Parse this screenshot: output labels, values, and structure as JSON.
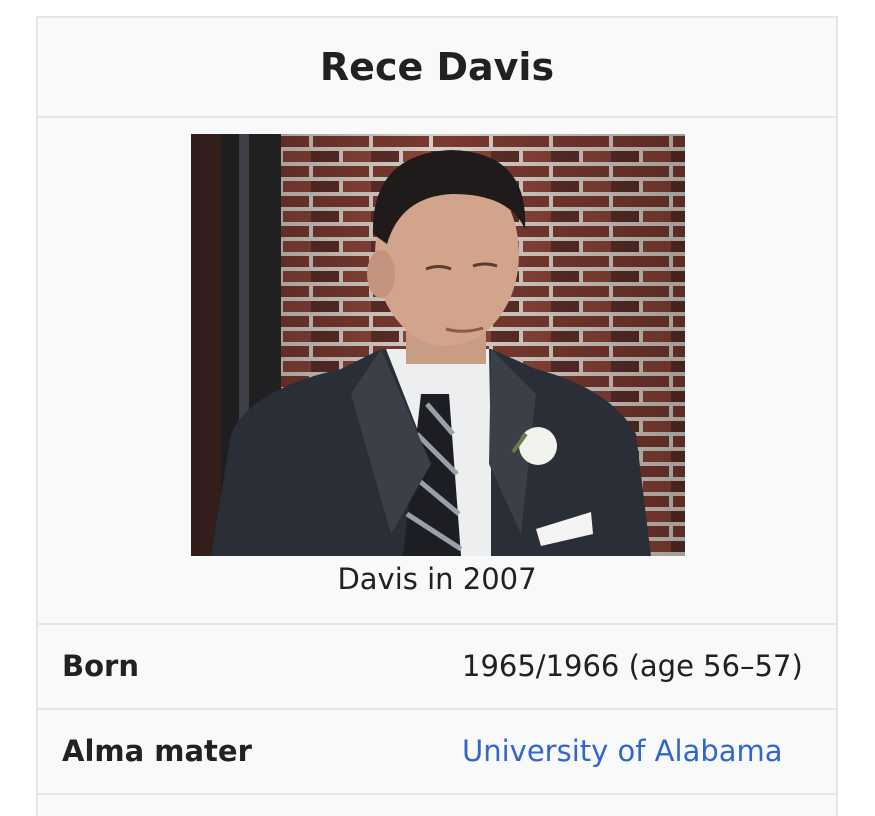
{
  "infobox": {
    "title": "Rece Davis",
    "image": {
      "caption": "Davis in 2007"
    },
    "rows": [
      {
        "label": "Born",
        "value": "1965/1966 (age 56–57)"
      },
      {
        "label": "Alma mater",
        "value": "University of Alabama"
      }
    ]
  },
  "colors": {
    "background": "#f8f9fa",
    "border": "#e4e6e8",
    "link": "#3366cc",
    "text": "#202122"
  }
}
